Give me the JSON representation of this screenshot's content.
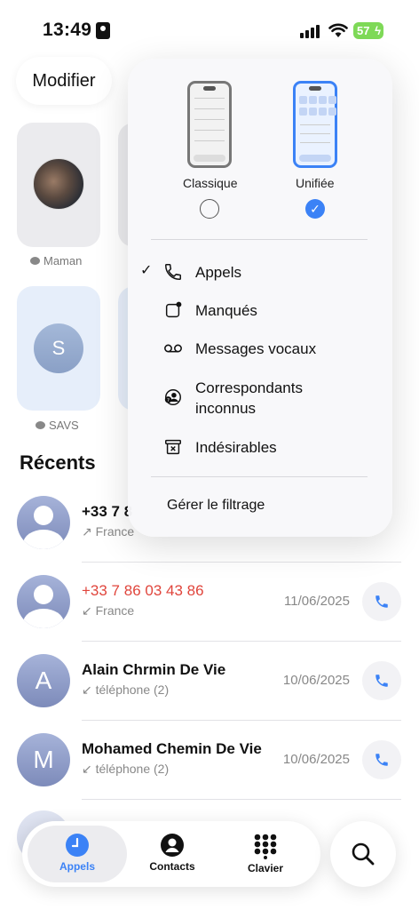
{
  "status": {
    "time": "13:49",
    "battery": "57"
  },
  "header": {
    "edit_label": "Modifier"
  },
  "favorites": [
    {
      "name": "Maman"
    },
    {
      "name": "SAVS",
      "initial": "S"
    }
  ],
  "recents": {
    "title": "Récents",
    "rows": [
      {
        "name": "+33 7 8",
        "sub": "↗ France",
        "date": "",
        "missed": false
      },
      {
        "name": "+33 7 86 03 43 86",
        "sub": "↙ France",
        "date": "11/06/2025",
        "missed": true
      },
      {
        "name": "Alain Chrmin De Vie",
        "sub": "↙ téléphone (2)",
        "date": "10/06/2025",
        "initial": "A",
        "missed": false
      },
      {
        "name": "Mohamed Chemin De Vie",
        "sub": "↙ téléphone (2)",
        "date": "10/06/2025",
        "initial": "M",
        "missed": false
      }
    ]
  },
  "popover": {
    "styles": [
      {
        "label": "Classique",
        "selected": false
      },
      {
        "label": "Unifiée",
        "selected": true
      }
    ],
    "items": [
      {
        "label": "Appels",
        "checked": true,
        "icon": "phone-icon"
      },
      {
        "label": "Manqués",
        "checked": false,
        "icon": "missed-icon"
      },
      {
        "label": "Messages vocaux",
        "checked": false,
        "icon": "voicemail-icon"
      },
      {
        "label": "Correspondants inconnus",
        "checked": false,
        "icon": "unknown-caller-icon"
      },
      {
        "label": "Indésirables",
        "checked": false,
        "icon": "junk-icon"
      }
    ],
    "manage_label": "Gérer le filtrage"
  },
  "tabbar": {
    "tabs": [
      {
        "label": "Appels",
        "active": true
      },
      {
        "label": "Contacts",
        "active": false
      },
      {
        "label": "Clavier",
        "active": false
      }
    ]
  },
  "colors": {
    "accent": "#3b82f6",
    "missed": "#e0453c",
    "battery": "#7ed957"
  }
}
